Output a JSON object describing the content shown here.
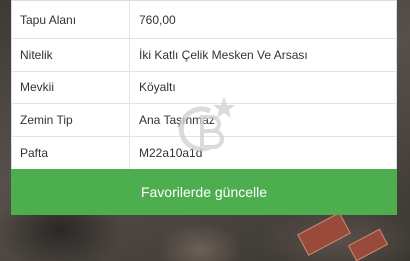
{
  "details": {
    "rows": [
      {
        "label": "Tapu Alanı",
        "value": "760,00"
      },
      {
        "label": "Nitelik",
        "value": "İki Katlı Çelik Mesken Ve Arsası"
      },
      {
        "label": "Mevkii",
        "value": "Köyaltı"
      },
      {
        "label": "Zemin Tip",
        "value": "Ana Taşınmaz"
      },
      {
        "label": "Pafta",
        "value": "M22a10a1d"
      }
    ]
  },
  "actions": {
    "update_favorites_label": "Favorilerde güncelle"
  },
  "watermark": {
    "icon": "cb-logo-icon",
    "color": "#cfcfcf"
  },
  "colors": {
    "button": "#4cae4f",
    "button_text": "#ffffff"
  }
}
